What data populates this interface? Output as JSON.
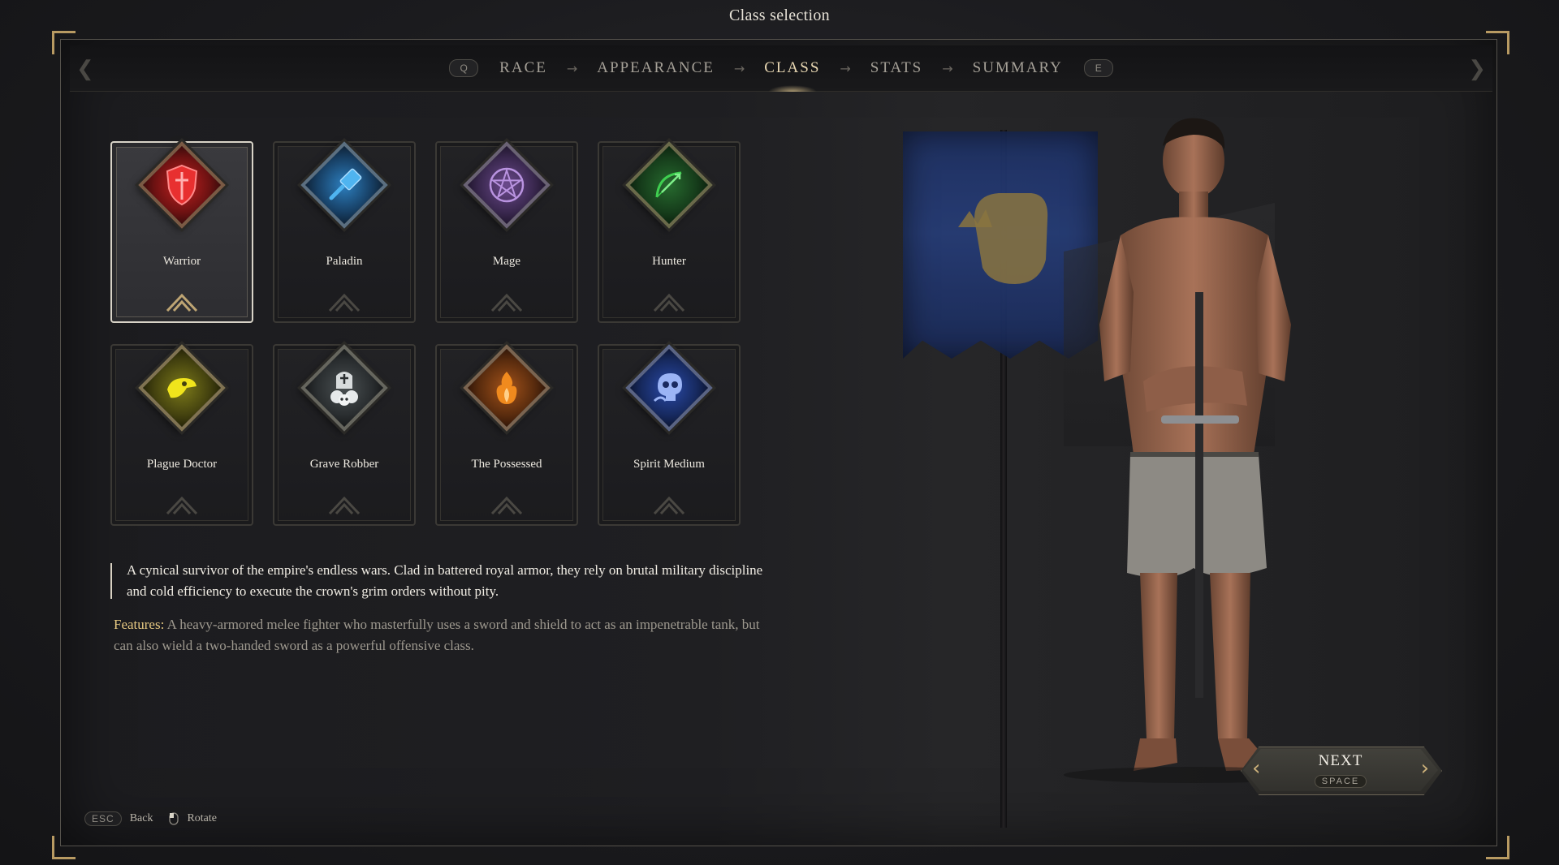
{
  "window_title": "Class selection",
  "steps": {
    "prev_key": "Q",
    "next_key": "E",
    "items": [
      {
        "label": "RACE",
        "active": false
      },
      {
        "label": "APPEARANCE",
        "active": false
      },
      {
        "label": "CLASS",
        "active": true
      },
      {
        "label": "STATS",
        "active": false
      },
      {
        "label": "SUMMARY",
        "active": false
      }
    ]
  },
  "classes": [
    {
      "name": "Warrior",
      "icon": "shield-icon",
      "color": "#d12a2a",
      "selected": true
    },
    {
      "name": "Paladin",
      "icon": "hammer-icon",
      "color": "#2f8fd0",
      "selected": false
    },
    {
      "name": "Mage",
      "icon": "pentagram-icon",
      "color": "#8e63b8",
      "selected": false
    },
    {
      "name": "Hunter",
      "icon": "bow-icon",
      "color": "#2e9a3e",
      "selected": false
    },
    {
      "name": "Plague Doctor",
      "icon": "plague-mask-icon",
      "color": "#e8dd1a",
      "selected": false
    },
    {
      "name": "Grave Robber",
      "icon": "skulls-tombstone-icon",
      "color": "#9aa3a6",
      "selected": false
    },
    {
      "name": "The Possessed",
      "icon": "flame-icon",
      "color": "#e07a1c",
      "selected": false
    },
    {
      "name": "Spirit Medium",
      "icon": "ghost-skull-icon",
      "color": "#4a6fd8",
      "selected": false
    }
  ],
  "description": {
    "lore": "A cynical survivor of the empire's endless wars. Clad in battered royal armor, they rely on brutal military discipline and cold efficiency to execute the crown's grim orders without pity.",
    "features_label": "Features:",
    "features_text": " A heavy-armored melee fighter who masterfully uses a sword and shield to act as an impenetrable tank, but can also wield a two-handed sword as a powerful offensive class."
  },
  "next_button": {
    "label": "NEXT",
    "key": "SPACE"
  },
  "footer": {
    "back_key": "ESC",
    "back_label": "Back",
    "rotate_label": "Rotate"
  }
}
